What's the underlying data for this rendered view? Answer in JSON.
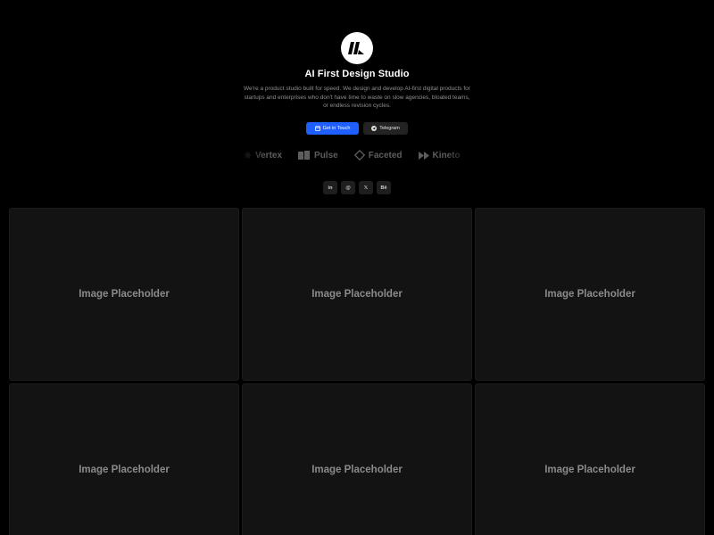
{
  "hero": {
    "title": "AI First Design Studio",
    "description": "We're a product studio built for speed. We design and develop AI-first digital products for startups and enterprises who don't have time to waste on slow agencies, bloated teams, or endless revision cycles.",
    "primary_button": "Get in Touch",
    "secondary_button": "Telegram"
  },
  "brands": [
    {
      "name": "Vertex",
      "icon": "asterisk-icon"
    },
    {
      "name": "Pulse",
      "icon": "bars-icon"
    },
    {
      "name": "Faceted",
      "icon": "diamond-icon"
    },
    {
      "name": "Kineto",
      "icon": "fast-forward-icon"
    }
  ],
  "social": {
    "linkedin": "in",
    "threads": "@",
    "x": "𝕏",
    "behance": "Bē"
  },
  "cards": [
    {
      "label": "Image Placeholder"
    },
    {
      "label": "Image Placeholder"
    },
    {
      "label": "Image Placeholder"
    },
    {
      "label": "Image Placeholder"
    },
    {
      "label": "Image Placeholder"
    },
    {
      "label": "Image Placeholder"
    }
  ],
  "colors": {
    "background": "#000000",
    "accent": "#1f5fff",
    "card": "#131313",
    "muted_text": "#8f8f8f"
  }
}
